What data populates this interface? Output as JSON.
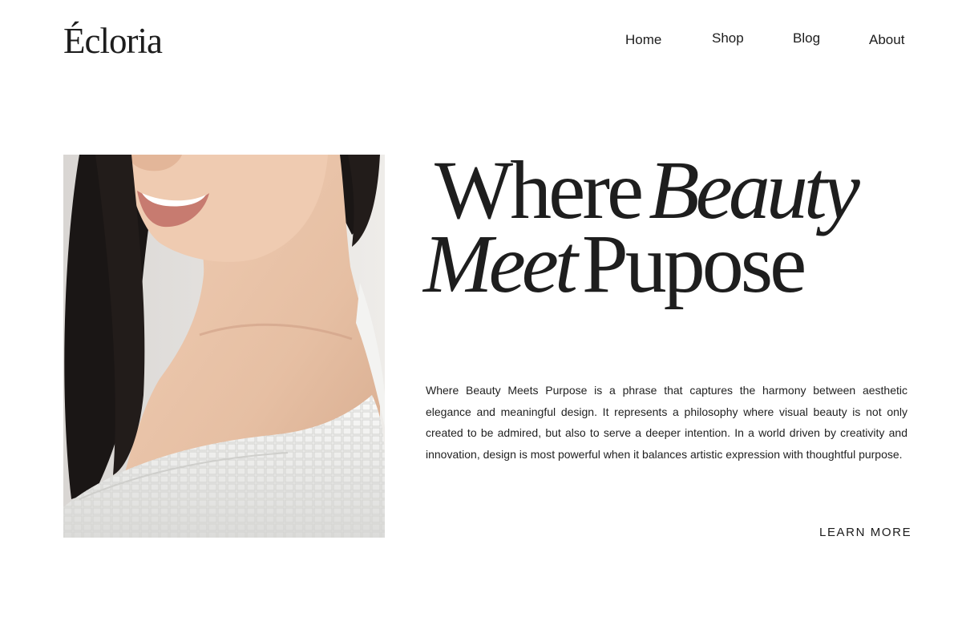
{
  "brand": {
    "logo_text": "Écloria"
  },
  "nav": {
    "items": [
      {
        "label": "Home"
      },
      {
        "label": "Shop"
      },
      {
        "label": "Blog"
      },
      {
        "label": "About"
      }
    ]
  },
  "hero": {
    "headline": {
      "line1_a": "Where",
      "line1_b": "Beauty",
      "line2_a": "Meet",
      "line2_b": "Pupose"
    },
    "description": "Where Beauty Meets Purpose is a phrase that captures the harmony between aesthetic elegance and meaningful design. It represents a philosophy where visual beauty is not only created to be admired, but also to serve a deeper intention. In a world driven by creativity and innovation, design is most powerful when it balances artistic expression with thoughtful purpose.",
    "cta_label": "LEARN MORE",
    "image_icon": "portrait-photo"
  },
  "colors": {
    "background": "#ffffff",
    "text": "#1c1c1c",
    "skin": "#e8c3a9",
    "hair": "#1a1615",
    "robe": "#f1f1ef"
  }
}
